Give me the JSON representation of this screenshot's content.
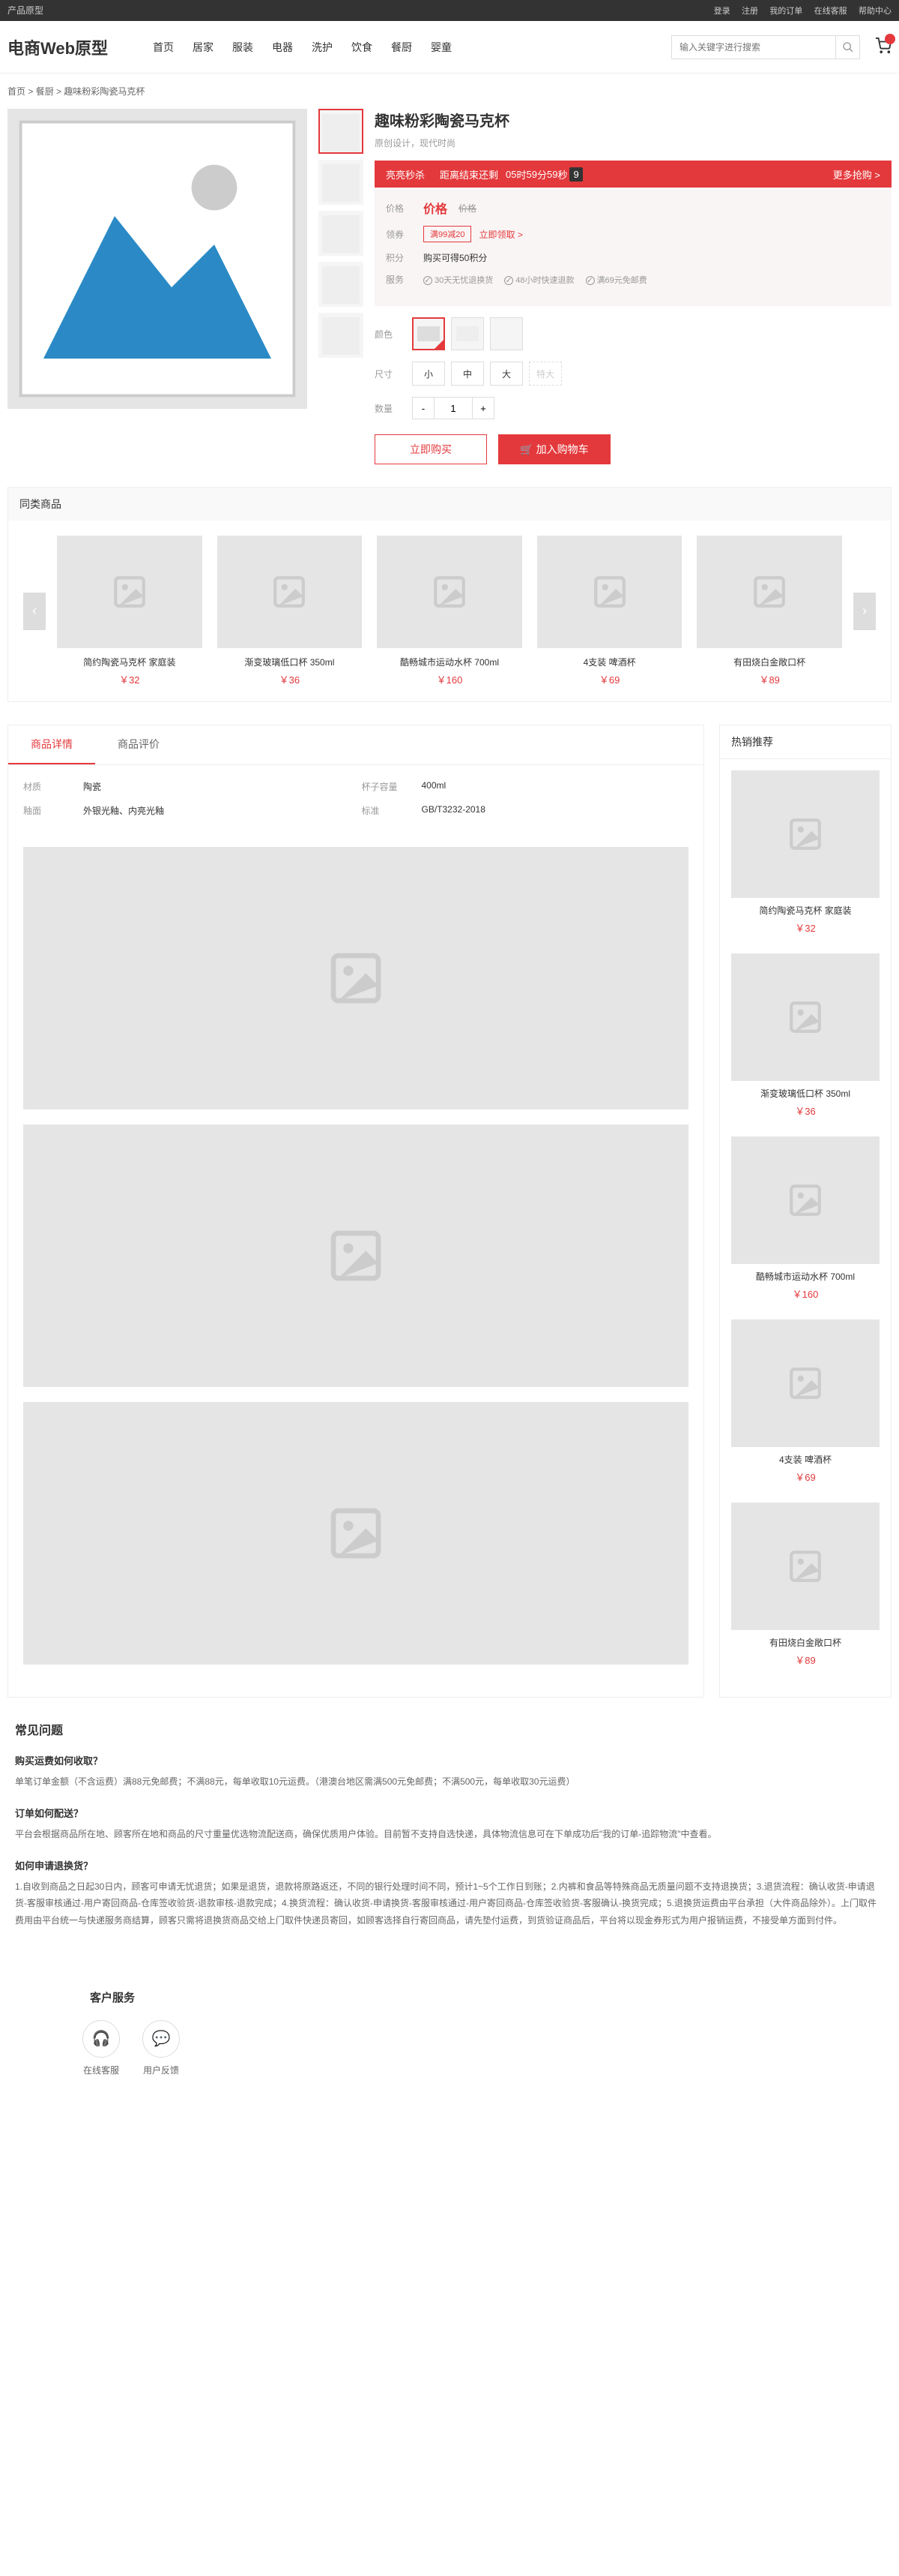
{
  "topbar": {
    "left": "产品原型",
    "links": [
      "登录",
      "注册",
      "我的订单",
      "在线客服",
      "帮助中心"
    ]
  },
  "header": {
    "logo": "电商Web原型",
    "nav": [
      "首页",
      "居家",
      "服装",
      "电器",
      "洗护",
      "饮食",
      "餐厨",
      "婴童"
    ],
    "search_placeholder": "输入关键字进行搜索",
    "cart_count": ""
  },
  "breadcrumb": {
    "items": [
      "首页",
      "餐厨",
      "趣味粉彩陶瓷马克杯"
    ]
  },
  "product": {
    "title": "趣味粉彩陶瓷马克杯",
    "subtitle": "原创设计，现代时尚",
    "flash": {
      "label": "亮亮秒杀",
      "countdown_label": "距离结束还剩",
      "h": "05",
      "h_unit": "时",
      "m": "59",
      "m_unit": "分",
      "s": "59",
      "s_unit": "秒",
      "ms": "9",
      "more": "更多抢购 >"
    },
    "price": {
      "label": "价格",
      "value": "价格",
      "old": "价格"
    },
    "coupon": {
      "label": "领券",
      "tag": "满99减20",
      "link": "立即领取 >"
    },
    "points": {
      "label": "积分",
      "value": "购买可得50积分"
    },
    "services": {
      "label": "服务",
      "items": [
        "30天无忧退换货",
        "48小时快速退款",
        "满69元免邮费"
      ]
    },
    "color": {
      "label": "颜色"
    },
    "size": {
      "label": "尺寸",
      "options": [
        "小",
        "中",
        "大",
        "特大"
      ]
    },
    "qty": {
      "label": "数量",
      "value": "1"
    },
    "buy_now": "立即购买",
    "add_cart": "加入购物车"
  },
  "similar": {
    "title": "同类商品",
    "items": [
      {
        "name": "简约陶瓷马克杯 家庭装",
        "price": "￥32"
      },
      {
        "name": "渐变玻璃低口杯 350ml",
        "price": "￥36"
      },
      {
        "name": "酷畅城市运动水杯 700ml",
        "price": "￥160"
      },
      {
        "name": "4支装 啤酒杯",
        "price": "￥69"
      },
      {
        "name": "有田烧白金敞口杯",
        "price": "￥89"
      }
    ]
  },
  "detail": {
    "tabs": [
      "商品详情",
      "商品评价"
    ],
    "specs": [
      {
        "label": "材质",
        "value": "陶瓷"
      },
      {
        "label": "杯子容量",
        "value": "400ml"
      },
      {
        "label": "釉面",
        "value": "外银光釉、内亮光釉"
      },
      {
        "label": "标准",
        "value": "GB/T3232-2018"
      }
    ]
  },
  "hot": {
    "title": "热销推荐",
    "items": [
      {
        "name": "简约陶瓷马克杯 家庭装",
        "price": "￥32"
      },
      {
        "name": "渐变玻璃低口杯 350ml",
        "price": "￥36"
      },
      {
        "name": "酷畅城市运动水杯 700ml",
        "price": "￥160"
      },
      {
        "name": "4支装 啤酒杯",
        "price": "￥69"
      },
      {
        "name": "有田烧白金敞口杯",
        "price": "￥89"
      }
    ]
  },
  "faq": {
    "title": "常见问题",
    "items": [
      {
        "q": "购买运费如何收取？",
        "a": "单笔订单金额（不含运费）满88元免邮费；不满88元，每单收取10元运费。（港澳台地区需满500元免邮费；不满500元，每单收取30元运费）"
      },
      {
        "q": "订单如何配送？",
        "a": "平台会根据商品所在地、顾客所在地和商品的尺寸重量优选物流配送商，确保优质用户体验。目前暂不支持自选快递，具体物流信息可在下单成功后\"我的订单-追踪物流\"中查看。"
      },
      {
        "q": "如何申请退换货？",
        "a": "1.自收到商品之日起30日内，顾客可申请无忧退货；如果是退货，退款将原路返还，不同的银行处理时间不同，预计1~5个工作日到账；2.内裤和食品等特殊商品无质量问题不支持退换货；3.退货流程：确认收货-申请退货-客服审核通过-用户寄回商品-仓库签收验货-退款审核-退款完成；4.换货流程：确认收货-申请换货-客服审核通过-用户寄回商品-仓库签收验货-客服确认-换货完成；5.退换货运费由平台承担（大件商品除外）。上门取件费用由平台统一与快递服务商结算，顾客只需将退换货商品交给上门取件快递员寄回，如顾客选择自行寄回商品，请先垫付运费，到货验证商品后，平台将以现金券形式为用户报销运费，不接受单方面到付件。"
      }
    ]
  },
  "service": {
    "title": "客户服务",
    "items": [
      "在线客服",
      "用户反馈"
    ]
  }
}
